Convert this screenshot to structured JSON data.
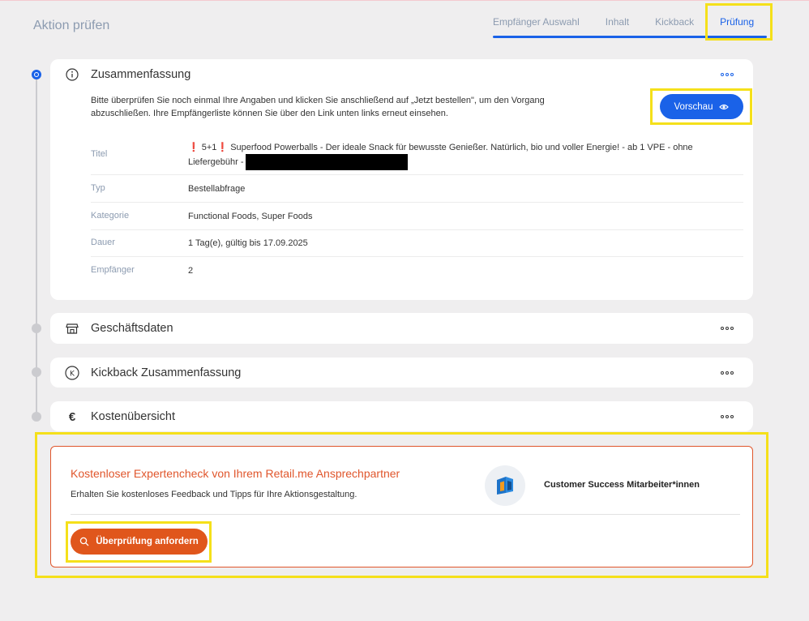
{
  "page": {
    "title": "Aktion prüfen"
  },
  "tabs": [
    {
      "label": "Empfänger Auswahl"
    },
    {
      "label": "Inhalt"
    },
    {
      "label": "Kickback"
    },
    {
      "label": "Prüfung",
      "active": true
    }
  ],
  "summary": {
    "title": "Zusammenfassung",
    "intro": "Bitte überprüfen Sie noch einmal Ihre Angaben und klicken Sie anschließend auf „Jetzt bestellen\", um den Vorgang abzuschließen. Ihre Empfängerliste können Sie über den Link unten links erneut einsehen.",
    "preview_label": "Vorschau",
    "rows": [
      {
        "key": "Titel",
        "value_prefix": "❗",
        "value_mid": "5+1",
        "value_excl": "❗",
        "value": "Superfood Powerballs - Der ideale Snack für bewusste Genießer. Natürlich, bio und voller Energie! - ab 1 VPE - ohne Liefergebühr -"
      },
      {
        "key": "Typ",
        "value": "Bestellabfrage"
      },
      {
        "key": "Kategorie",
        "value": "Functional Foods, Super Foods"
      },
      {
        "key": "Dauer",
        "value": "1 Tag(e), gültig bis 17.09.2025"
      },
      {
        "key": "Empfänger",
        "value": "2"
      }
    ]
  },
  "sections": [
    {
      "title": "Geschäftsdaten",
      "icon": "store-icon"
    },
    {
      "title": "Kickback Zusammenfassung",
      "icon": "kickback-icon"
    },
    {
      "title": "Kostenübersicht",
      "icon": "euro-icon",
      "icon_glyph": "€"
    }
  ],
  "promo": {
    "title": "Kostenloser Expertencheck von Ihrem Retail.me Ansprechpartner",
    "subtitle": "Erhalten Sie kostenloses Feedback und Tipps für Ihre Aktionsgestaltung.",
    "button_label": "Überprüfung anfordern",
    "team_label": "Customer Success Mitarbeiter*innen"
  },
  "colors": {
    "accent": "#1a62e8",
    "orange": "#e0561c",
    "highlight": "#f5e01a",
    "background": "#efeeef"
  }
}
